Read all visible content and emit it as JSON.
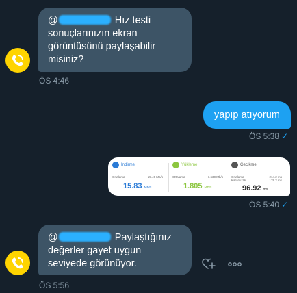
{
  "colors": {
    "background": "#15202b",
    "incoming_bubble": "#3d5466",
    "outgoing_bubble": "#1da1f2",
    "avatar": "#ffd400",
    "timestamp": "#8899a6",
    "speed_blue": "#2b7bd6",
    "speed_green": "#8cc63f"
  },
  "messages": [
    {
      "mention": "@",
      "text": " Hız testi sonuçlarınızın ekran görüntüsünü paylaşabilir misiniz?",
      "time": "ÖS 4:46"
    },
    {
      "text": "yapıp atıyorum",
      "time": "ÖS 5:38",
      "status_icon": "✓"
    },
    {
      "time": "ÖS 5:40",
      "status_icon": "✓",
      "speedtest": {
        "download": {
          "label": "İndirme",
          "avg_label": "Ortalama",
          "avg_value": "15.45 Mb/s",
          "value": "15.83",
          "unit": "Mb/s",
          "icon": "download-icon"
        },
        "upload": {
          "label": "Yükleme",
          "avg_label": "Ortalama",
          "avg_value": "1.630 Mb/s",
          "value": "1.805",
          "unit": "Mb/s",
          "icon": "upload-icon"
        },
        "latency": {
          "label": "Gecikme",
          "avg_label": "Ortalama",
          "jitter_label": "Kararsızlık",
          "avg_value": "214.2 ms",
          "jitter_value": "179.2 ms",
          "value": "96.92",
          "unit": "ms",
          "icon": "latency-icon"
        }
      }
    },
    {
      "mention": "@",
      "text": " Paylaştığınız değerler gayet uygun seviyede görünüyor.",
      "time": "ÖS 5:56"
    }
  ],
  "actions": {
    "react_icon": "heart-plus-icon",
    "more_icon": "more-horizontal-icon"
  }
}
